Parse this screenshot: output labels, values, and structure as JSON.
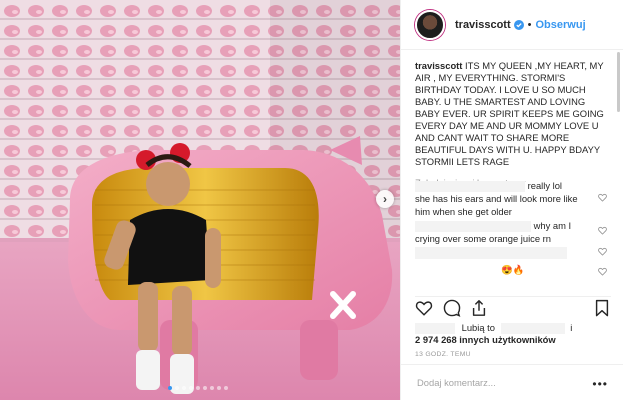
{
  "post": {
    "username": "travisscott",
    "follow_label": "Obserwuj",
    "separator": "•",
    "caption": "ITS MY QUEEN ,MY HEART, MY AIR , MY EVERYTHING. STORMI'S BIRTHDAY TODAY. I LOVE U SO MUCH BABY. U THE SMARTEST AND LOVING BABY EVER. UR SPIRIT KEEPS ME GOING EVERY DAY ME AND UR MOMMY LOVE U AND CANT WAIT TO SHARE MORE BEAUTIFUL DAYS WITH U. HAPPY BDAYY STORMII LETS RAGE",
    "load_more_label": "Załaduj więcej komentarzy",
    "comments": [
      {
        "text": "really lol"
      },
      {
        "text": "she has his ears and will look more like him when she get older"
      },
      {
        "text": "why am I crying over some orange juice rn"
      },
      {
        "text": "😍🔥"
      }
    ],
    "likes_prefix": "Lubią to",
    "likes_suffix": "i",
    "likes_count_text": "2 974 268 innych użytkowników",
    "timestamp": "13 GODZ. TEMU",
    "add_comment_placeholder": "Dodaj komentarz...",
    "more_label": "•••",
    "next_arrow": "›",
    "carousel": {
      "count": 9,
      "active_index": 0
    }
  },
  "icons": {
    "verified": "verified-badge-icon",
    "like": "heart-icon",
    "comment": "comment-bubble-icon",
    "share": "share-icon",
    "save": "bookmark-icon"
  },
  "colors": {
    "accent": "#3897f0",
    "text": "#262626",
    "muted": "#999999"
  }
}
